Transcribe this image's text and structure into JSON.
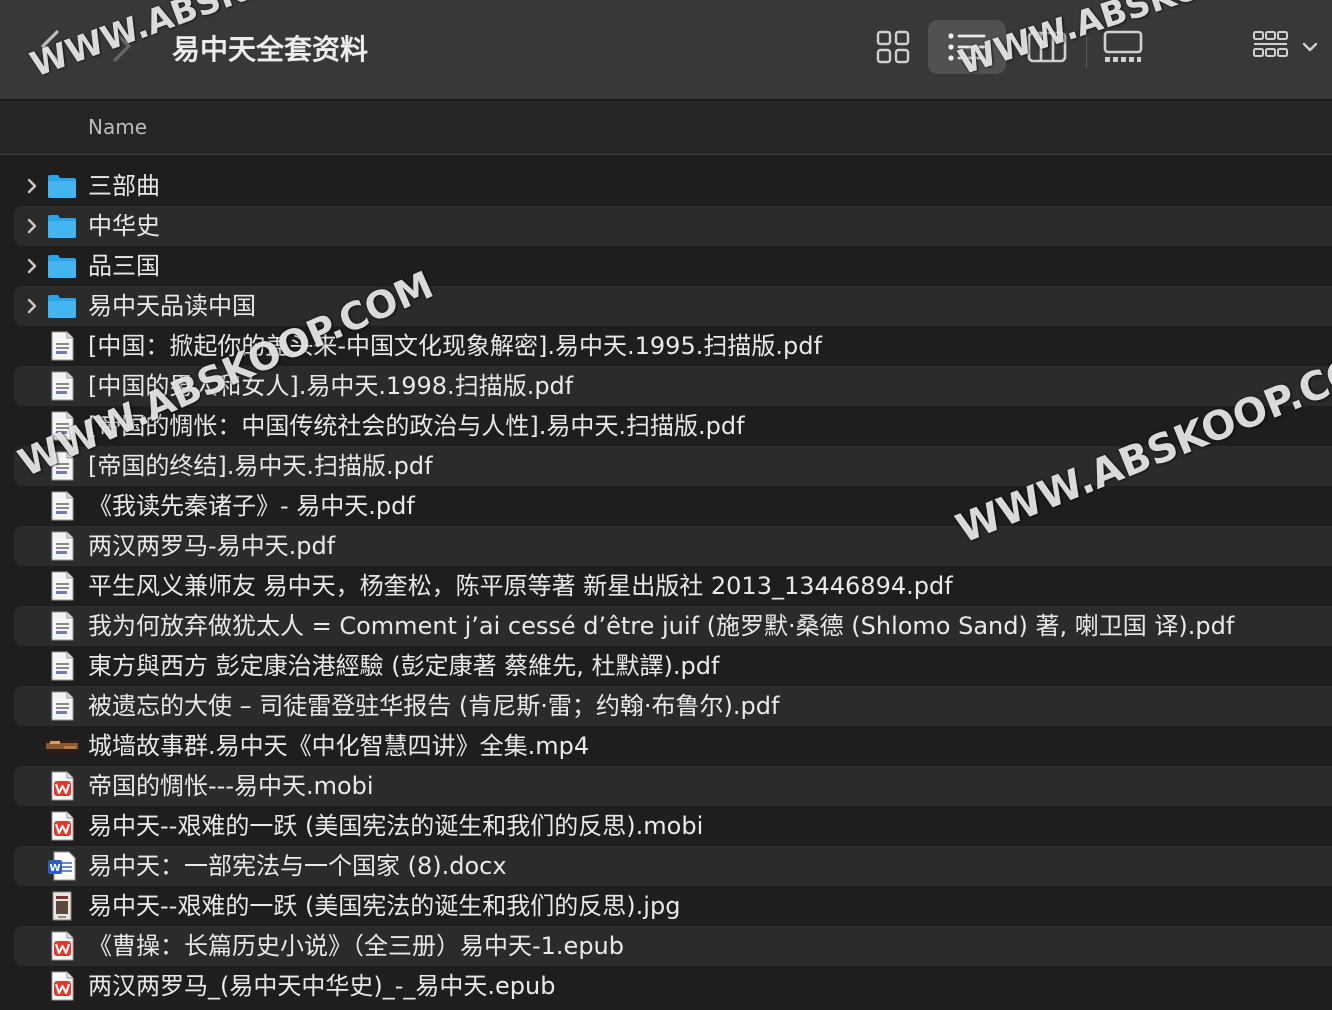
{
  "window": {
    "title": "易中天全套资料"
  },
  "columns": {
    "name": "Name"
  },
  "files": [
    {
      "name": "三部曲",
      "kind": "folder",
      "icon": "folder-icon"
    },
    {
      "name": "中华史",
      "kind": "folder",
      "icon": "folder-icon"
    },
    {
      "name": "品三国",
      "kind": "folder",
      "icon": "folder-icon"
    },
    {
      "name": "易中天品读中国",
      "kind": "folder",
      "icon": "folder-icon"
    },
    {
      "name": "[中国：掀起你的盖头来-中国文化现象解密].易中天.1995.扫描版.pdf",
      "kind": "pdf",
      "icon": "pdf-file-icon"
    },
    {
      "name": "[中国的男人和女人].易中天.1998.扫描版.pdf",
      "kind": "pdf",
      "icon": "pdf-file-icon"
    },
    {
      "name": "[帝国的惆怅：中国传统社会的政治与人性].易中天.扫描版.pdf",
      "kind": "pdf",
      "icon": "pdf-file-icon"
    },
    {
      "name": "[帝国的终结].易中天.扫描版.pdf",
      "kind": "pdf",
      "icon": "pdf-file-icon"
    },
    {
      "name": "《我读先秦诸子》- 易中天.pdf",
      "kind": "pdf",
      "icon": "pdf-file-icon"
    },
    {
      "name": "两汉两罗马-易中天.pdf",
      "kind": "pdf",
      "icon": "pdf-file-icon"
    },
    {
      "name": "平生风义兼师友 易中天，杨奎松，陈平原等著 新星出版社 2013_13446894.pdf",
      "kind": "pdf",
      "icon": "pdf-file-icon"
    },
    {
      "name": "我为何放弃做犹太人 = Comment j’ai cessé d’être juif (施罗默·桑德 (Shlomo Sand) 著, 喇卫国 译).pdf",
      "kind": "pdf",
      "icon": "pdf-file-icon"
    },
    {
      "name": "東方與西方 彭定康治港經驗 (彭定康著 蔡維先, 杜默譯).pdf",
      "kind": "pdf",
      "icon": "pdf-file-icon"
    },
    {
      "name": "被遗忘的大使 – 司徒雷登驻华报告 (肯尼斯·雷；约翰·布鲁尔).pdf",
      "kind": "pdf",
      "icon": "pdf-file-icon"
    },
    {
      "name": "城墙故事群.易中天《中化智慧四讲》全集.mp4",
      "kind": "video",
      "icon": "video-thumbnail-icon"
    },
    {
      "name": "帝国的惆怅---易中天.mobi",
      "kind": "ebook",
      "icon": "wps-ebook-icon"
    },
    {
      "name": "易中天--艰难的一跃 (美国宪法的诞生和我们的反思).mobi",
      "kind": "ebook",
      "icon": "wps-ebook-icon"
    },
    {
      "name": "易中天：一部宪法与一个国家 (8).docx",
      "kind": "docx",
      "icon": "word-document-icon"
    },
    {
      "name": "易中天--艰难的一跃 (美国宪法的诞生和我们的反思).jpg",
      "kind": "image",
      "icon": "image-thumbnail-icon"
    },
    {
      "name": "《曹操：长篇历史小说》（全三册）易中天-1.epub",
      "kind": "ebook",
      "icon": "wps-ebook-icon"
    },
    {
      "name": "两汉两罗马_(易中天中华史)_-_易中天.epub",
      "kind": "ebook",
      "icon": "wps-ebook-icon"
    }
  ],
  "watermarks": {
    "text": "WWW.ABSKOOP.COM"
  },
  "colors": {
    "folder": "#2aa4e8",
    "wps_red": "#e03a2f",
    "word_blue": "#2b5fc4"
  }
}
